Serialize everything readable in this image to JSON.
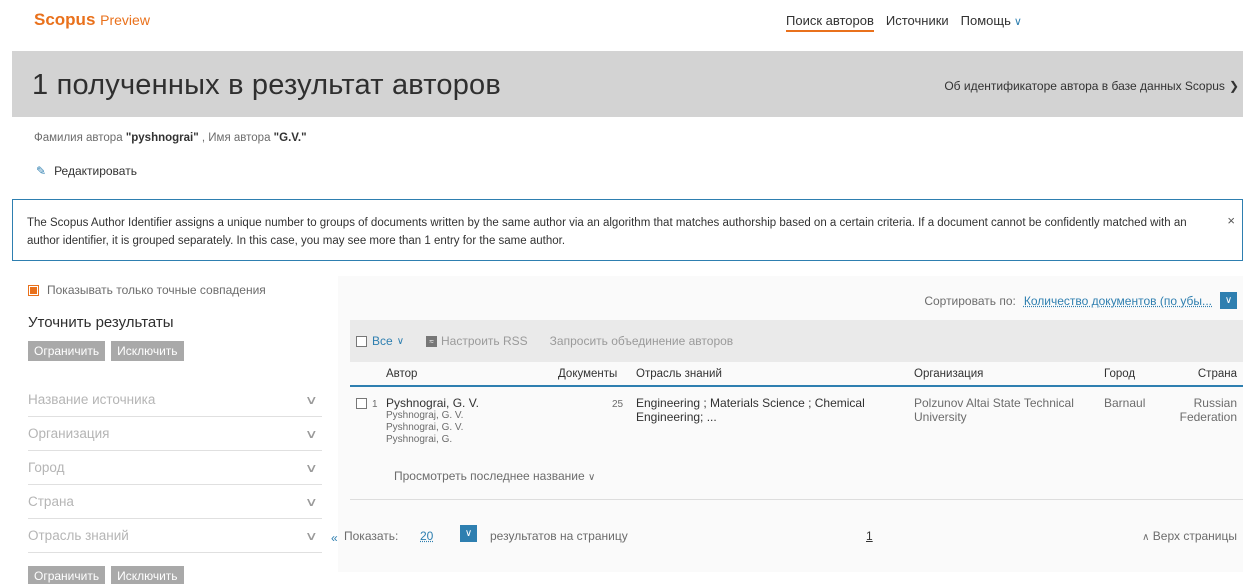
{
  "header": {
    "brand": "Scopus",
    "brand_suffix": "Preview",
    "nav": [
      {
        "label": "Поиск авторов"
      },
      {
        "label": "Источники"
      },
      {
        "label": "Помощь"
      }
    ]
  },
  "banner": {
    "title": "1 полученных в результат авторов",
    "about_link": "Об идентификаторе автора в базе данных Scopus"
  },
  "query": {
    "lastname_label": "Фамилия автора",
    "lastname_value": "\"pyshnograi\"",
    "firstname_label": ", Имя автора",
    "firstname_value": "\"G.V.\"",
    "edit_label": "Редактировать"
  },
  "info_box": {
    "text": "The Scopus Author Identifier assigns a unique number to groups of documents written by the same author via an algorithm that matches authorship based on a certain criteria. If a document cannot be confidently matched with an author identifier, it is grouped separately. In this case, you may see more than 1 entry for the same author.",
    "close": "×"
  },
  "sidebar": {
    "exact_match": "Показывать только точные совпадения",
    "refine_title": "Уточнить результаты",
    "limit_label": "Ограничить",
    "exclude_label": "Исключить",
    "facets": [
      {
        "label": "Название источника"
      },
      {
        "label": "Организация"
      },
      {
        "label": "Город"
      },
      {
        "label": "Страна"
      },
      {
        "label": "Отрасль знаний"
      }
    ]
  },
  "results": {
    "sort_label": "Сортировать по:",
    "sort_value": "Количество документов (по убы...",
    "toolbar": {
      "all_label": "Все",
      "rss_label": "Настроить RSS",
      "merge_label": "Запросить объединение авторов"
    },
    "columns": [
      "Автор",
      "Документы",
      "Отрасль знаний",
      "Организация",
      "Город",
      "Страна"
    ],
    "rows": [
      {
        "index": "1",
        "author": "Pyshnograi, G. V.",
        "variants": [
          "Pyshnograj, G. V.",
          "Pyshnograi, G. V.",
          "Pyshnograi, G."
        ],
        "documents": "25",
        "subject": "Engineering ; Materials Science ; Chemical Engineering; ...",
        "organization": "Polzunov Altai State Technical University",
        "city": "Barnaul",
        "country": "Russian Federation",
        "last_title_link": "Просмотреть последнее название"
      }
    ],
    "pager": {
      "show_label": "Показать:",
      "per_page_value": "20",
      "per_page_suffix": "результатов на страницу",
      "page": "1",
      "top_link": "Верх страницы"
    }
  },
  "colors": {
    "accent": "#e9711c",
    "link": "#2e7fb0",
    "banner_bg": "#d3d3d3"
  }
}
